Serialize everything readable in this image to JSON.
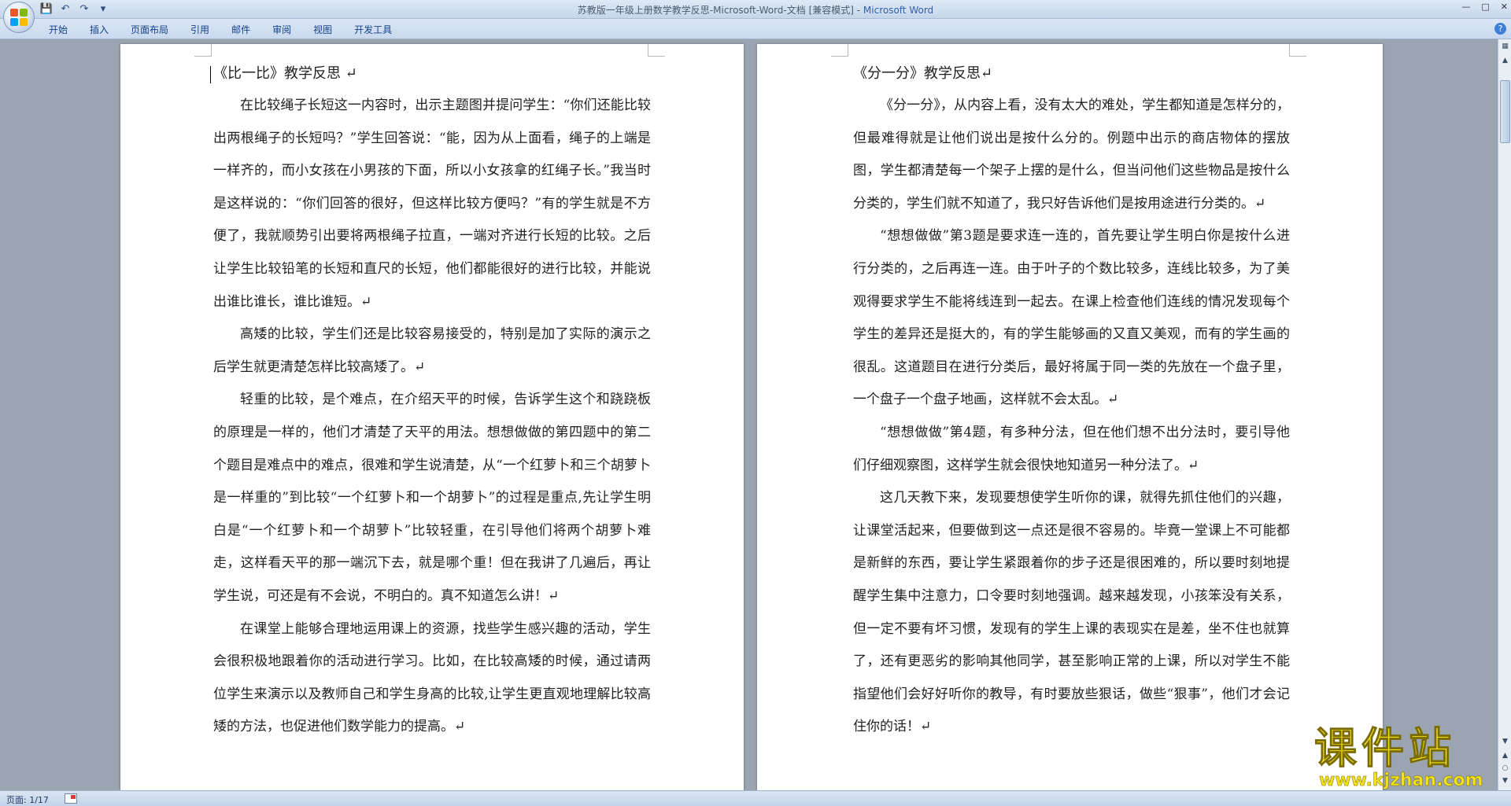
{
  "window": {
    "title": "苏教版一年级上册数学教学反思-Microsoft-Word-文档 [兼容模式] - ",
    "app_name": "Microsoft Word"
  },
  "ribbon": {
    "tabs": [
      "开始",
      "插入",
      "页面布局",
      "引用",
      "邮件",
      "审阅",
      "视图",
      "开发工具"
    ]
  },
  "status": {
    "page_label": "页面: 1/17"
  },
  "left_page": {
    "title": "《比一比》教学反思 ↵",
    "paragraphs": [
      "在比较绳子长短这一内容时，出示主题图并提问学生：“你们还能比较出两根绳子的长短吗？”学生回答说：“能，因为从上面看，绳子的上端是一样齐的，而小女孩在小男孩的下面，所以小女孩拿的红绳子长。”我当时是这样说的：“你们回答的很好，但这样比较方便吗？”有的学生就是不方便了，我就顺势引出要将两根绳子拉直，一端对齐进行长短的比较。之后让学生比较铅笔的长短和直尺的长短，他们都能很好的进行比较，并能说出谁比谁长，谁比谁短。↵",
      "高矮的比较，学生们还是比较容易接受的，特别是加了实际的演示之后学生就更清楚怎样比较高矮了。↵",
      "轻重的比较，是个难点，在介绍天平的时候，告诉学生这个和跷跷板的原理是一样的，他们才清楚了天平的用法。想想做做的第四题中的第二个题目是难点中的难点，很难和学生说清楚，从“一个红萝卜和三个胡萝卜是一样重的”到比较“一个红萝卜和一个胡萝卜”的过程是重点,先让学生明白是“一个红萝卜和一个胡萝卜”比较轻重，在引导他们将两个胡萝卜难走，这样看天平的那一端沉下去，就是哪个重！但在我讲了几遍后，再让学生说，可还是有不会说，不明白的。真不知道怎么讲！↵",
      "在课堂上能够合理地运用课上的资源，找些学生感兴趣的活动，学生会很积极地跟着你的活动进行学习。比如，在比较高矮的时候，通过请两位学生来演示以及教师自己和学生身高的比较,让学生更直观地理解比较高矮的方法，也促进他们数学能力的提高。↵"
    ]
  },
  "right_page": {
    "title": "《分一分》教学反思↵",
    "paragraphs": [
      "《分一分》，从内容上看，没有太大的难处，学生都知道是怎样分的，但最难得就是让他们说出是按什么分的。例题中出示的商店物体的摆放图，学生都清楚每一个架子上摆的是什么，但当问他们这些物品是按什么分类的，学生们就不知道了，我只好告诉他们是按用途进行分类的。↵",
      "“想想做做”第3题是要求连一连的，首先要让学生明白你是按什么进行分类的，之后再连一连。由于叶子的个数比较多，连线比较多，为了美观得要求学生不能将线连到一起去。在课上检查他们连线的情况发现每个学生的差异还是挺大的，有的学生能够画的又直又美观，而有的学生画的很乱。这道题目在进行分类后，最好将属于同一类的先放在一个盘子里，一个盘子一个盘子地画，这样就不会太乱。↵",
      "“想想做做”第4题，有多种分法，但在他们想不出分法时，要引导他们仔细观察图，这样学生就会很快地知道另一种分法了。↵",
      "这几天教下来，发现要想使学生听你的课，就得先抓住他们的兴趣，让课堂活起来，但要做到这一点还是很不容易的。毕竟一堂课上不可能都是新鲜的东西，要让学生紧跟着你的步子还是很困难的，所以要时刻地提醒学生集中注意力，口令要时刻地强调。越来越发现，小孩笨没有关系，但一定不要有坏习惯，发现有的学生上课的表现实在是差，坐不住也就算了，还有更恶劣的影响其他同学，甚至影响正常的上课，所以对学生不能指望他们会好好听你的教导，有时要放些狠话，做些“狠事”，他们才会记住你的话！↵"
    ]
  },
  "watermark": {
    "text": "课件站",
    "url": "www.kjzhan.com"
  },
  "colors": {
    "ribbon_tab_text": "#15428b",
    "app_name": "#2f5fa8",
    "watermark": "#f2e21b"
  }
}
